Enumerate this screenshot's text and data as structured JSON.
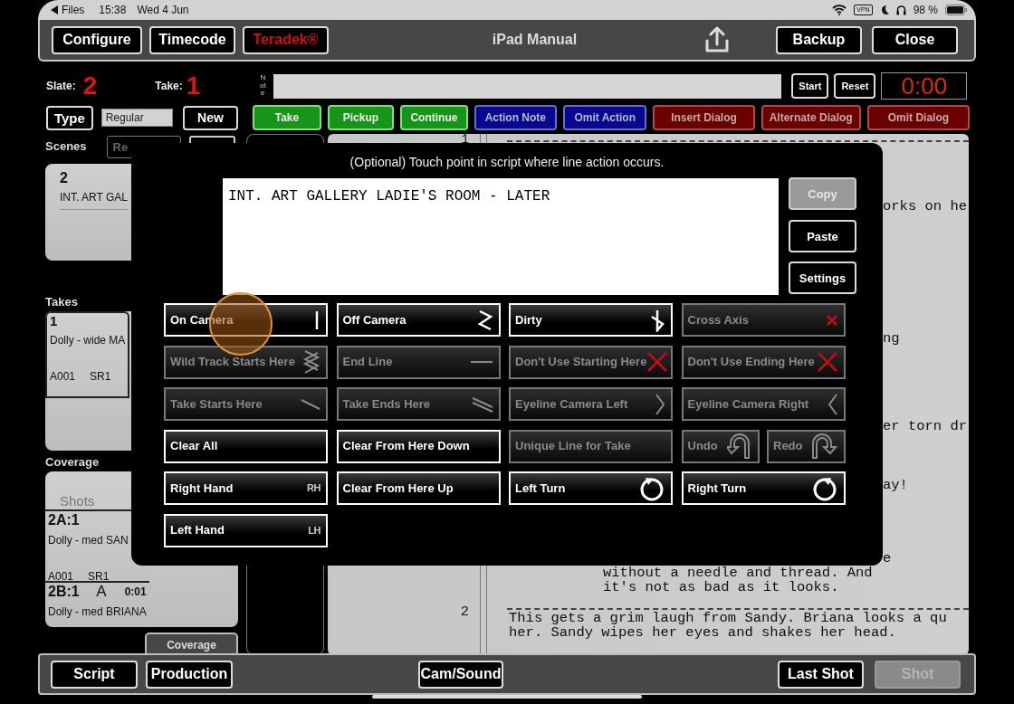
{
  "status_bar": {
    "back": "Files",
    "time": "15:38",
    "date": "Wed 4 Jun",
    "vpn": "VPN",
    "battery": "98 %"
  },
  "toolbar": {
    "left_buttons": [
      {
        "label": "Configure",
        "kind": "plain"
      },
      {
        "label": "Timecode",
        "kind": "plain"
      },
      {
        "label": "Teradek®",
        "kind": "alert"
      }
    ],
    "title": "iPad Manual",
    "right_buttons": [
      "Backup",
      "Close"
    ]
  },
  "slate": {
    "label": "Slate:",
    "value": "2"
  },
  "take": {
    "label": "Take:",
    "value": "1"
  },
  "note": {
    "label": "Note"
  },
  "timer": {
    "buttons": [
      "Start",
      "Reset"
    ],
    "display": "0:00"
  },
  "type_row": {
    "button": "Type",
    "value": "Regular",
    "new_button": "New"
  },
  "line_actions": [
    {
      "label": "Take",
      "kind": "take"
    },
    {
      "label": "Pickup",
      "kind": "take"
    },
    {
      "label": "Continue",
      "kind": "take"
    },
    {
      "label": "Action Note",
      "kind": "action"
    },
    {
      "label": "Omit Action",
      "kind": "action"
    },
    {
      "label": "Insert Dialog",
      "kind": "dialog"
    },
    {
      "label": "Alternate Dialog",
      "kind": "dialog"
    },
    {
      "label": "Omit Dialog",
      "kind": "dialog"
    }
  ],
  "scenes": {
    "label": "Scenes",
    "search_value": "Re",
    "items": [
      {
        "number": "2",
        "heading": "INT. ART GAL"
      }
    ]
  },
  "takes": {
    "label": "Takes",
    "items": [
      {
        "number": "1",
        "description": "Dolly - wide MA",
        "card": "A001",
        "sound": "SR1"
      }
    ]
  },
  "coverage": {
    "label": "Coverage",
    "shots_label": "Shots",
    "items": [
      {
        "id": "2A:1",
        "description": "Dolly - med SAN",
        "card": "A001",
        "sound": "SR1"
      },
      {
        "id": "2B:1",
        "camera": "A",
        "duration": "0:01",
        "description": "Dolly - med BRIANA"
      }
    ],
    "button": "Coverage"
  },
  "script": [
    {
      "number": "1",
      "lines": [
        {
          "kind": "fragment",
          "text": "orks on he"
        },
        {
          "kind": "fragment",
          "text": "ng"
        },
        {
          "kind": "fragment",
          "text": "er torn dr"
        },
        {
          "kind": "fragment",
          "text": "ay!"
        },
        {
          "kind": "fragment",
          "text": "e"
        },
        {
          "kind": "dialog",
          "text": "without a needle and thread. And"
        },
        {
          "kind": "dialog",
          "text": "it's not as bad as it looks."
        }
      ]
    },
    {
      "number": "2",
      "lines": [
        {
          "kind": "action",
          "text": "This gets a grim laugh from Sandy. Briana looks a qu"
        },
        {
          "kind": "action",
          "text": "her. Sandy wipes her eyes and shakes her head."
        }
      ]
    }
  ],
  "modal": {
    "title": "(Optional) Touch point in script where line action occurs.",
    "text": "INT. ART GALLERY LADIE'S ROOM - LATER",
    "side_buttons": [
      {
        "label": "Copy",
        "disabled": true
      },
      {
        "label": "Paste",
        "disabled": false
      },
      {
        "label": "Settings",
        "disabled": false
      }
    ],
    "actions": [
      {
        "label": "On Camera",
        "kind": "bar",
        "disabled": false
      },
      {
        "label": "Off Camera",
        "kind": "zigzag",
        "disabled": false
      },
      {
        "label": "Dirty",
        "kind": "dirty",
        "disabled": false
      },
      {
        "label": "Cross Axis",
        "kind": "cross",
        "disabled": true
      },
      {
        "label": "Wild Track Starts Here",
        "kind": "wild",
        "disabled": true
      },
      {
        "label": "End Line",
        "kind": "dash",
        "disabled": true
      },
      {
        "label": "Don't Use Starting Here",
        "kind": "big-cross",
        "disabled": true
      },
      {
        "label": "Don't Use Ending Here",
        "kind": "big-cross",
        "disabled": true
      },
      {
        "label": "Take Starts Here",
        "kind": "slash",
        "disabled": true
      },
      {
        "label": "Take Ends Here",
        "kind": "double-slash",
        "disabled": true
      },
      {
        "label": "Eyeline Camera Left",
        "kind": "chevron-right",
        "disabled": true
      },
      {
        "label": "Eyeline Camera Right",
        "kind": "chevron-left",
        "disabled": true
      },
      {
        "label": "Clear All",
        "kind": "plain",
        "disabled": false
      },
      {
        "label": "Clear From Here Down",
        "kind": "plain",
        "disabled": false
      },
      {
        "label": "Unique Line for Take",
        "kind": "plain",
        "disabled": true
      },
      {
        "kind": "pair",
        "parts": [
          {
            "label": "Undo",
            "kind": "undo",
            "disabled": true
          },
          {
            "label": "Redo",
            "kind": "redo",
            "disabled": true
          }
        ]
      },
      {
        "label": "Right Hand",
        "kind": "badge",
        "badge": "RH",
        "disabled": false
      },
      {
        "label": "Clear From Here Up",
        "kind": "plain",
        "disabled": false
      },
      {
        "label": "Left Turn",
        "kind": "turn-left",
        "disabled": false
      },
      {
        "label": "Right Turn",
        "kind": "turn-right",
        "disabled": false
      },
      {
        "label": "Left Hand",
        "kind": "badge",
        "badge": "LH",
        "disabled": false
      }
    ]
  },
  "bottom_bar": {
    "left_buttons": [
      "Script",
      "Production"
    ],
    "center_button": "Cam/Sound",
    "right_buttons": [
      {
        "label": "Last Shot",
        "disabled": false
      },
      {
        "label": "Shot",
        "disabled": true
      }
    ]
  }
}
